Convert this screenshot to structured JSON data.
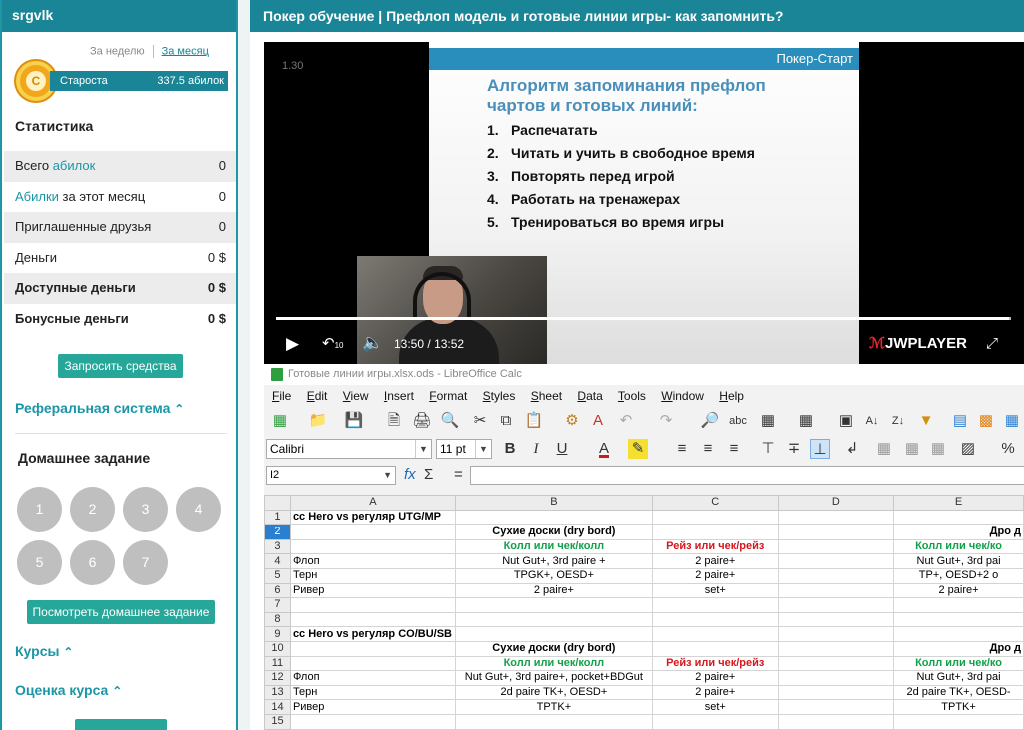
{
  "sidebar": {
    "username": "srgvlk",
    "period_week": "За неделю",
    "period_month": "За месяц",
    "coin_letter": "С",
    "rank": "Староста",
    "rank_points": "337.5 абилок",
    "stats_title": "Статистика",
    "stats": [
      {
        "pre": "Всего ",
        "link": "абилок",
        "post": "",
        "value": "0"
      },
      {
        "pre": "",
        "link": "Абилки",
        "post": " за этот месяц",
        "value": "0"
      },
      {
        "pre": "Приглашенные друзья",
        "link": "",
        "post": "",
        "value": "0"
      },
      {
        "pre": "Деньги",
        "link": "",
        "post": "",
        "value": "0 $"
      },
      {
        "pre": "Доступные деньги",
        "link": "",
        "post": "",
        "value": "0 $"
      },
      {
        "pre": "Бонусные деньги",
        "link": "",
        "post": "",
        "value": "0 $"
      }
    ],
    "request_funds": "Запросить средства",
    "referral": "Реферальная система",
    "homework_title": "Домашнее задание",
    "lessons": [
      "1",
      "2",
      "3",
      "4",
      "5",
      "6",
      "7"
    ],
    "view_homework": "Посмотреть домашнее задание",
    "courses": "Курсы",
    "course_rating": "Оценка курса",
    "chevron_up": "⌃"
  },
  "main": {
    "title": "Покер обучение | Префлоп модель и готовые линии игры- как запомнить?"
  },
  "video": {
    "timestamp_overlay": "1.30",
    "brand": "Покер-Старт",
    "slide_title_1": "Алгоритм запоминания префлоп",
    "slide_title_2": "чартов и готовых линий:",
    "slide_items": [
      {
        "n": "1.",
        "text": "Распечатать"
      },
      {
        "n": "2.",
        "text": "Читать и учить в свободное время"
      },
      {
        "n": "3.",
        "text": "Повторять перед игрой"
      },
      {
        "n": "4.",
        "text": "Работать на тренажерах"
      },
      {
        "n": "5.",
        "text": "Тренироваться во время игры"
      }
    ],
    "current_time": "13:50",
    "time_sep": "/",
    "duration": "13:52",
    "progress": 0.997,
    "player_logo_j": "ℳ",
    "player_logo": "JWPLAYER",
    "rewind_label": "10"
  },
  "calc": {
    "window_title": "Готовые линии игры.xlsx.ods - LibreOffice Calc",
    "menu": [
      {
        "u": "F",
        "rest": "ile"
      },
      {
        "u": "E",
        "rest": "dit"
      },
      {
        "u": "V",
        "rest": "iew"
      },
      {
        "u": "I",
        "rest": "nsert"
      },
      {
        "u": "F",
        "rest": "ormat"
      },
      {
        "u": "S",
        "rest": "tyles"
      },
      {
        "u": "S",
        "rest": "heet"
      },
      {
        "u": "D",
        "rest": "ata"
      },
      {
        "u": "T",
        "rest": "ools"
      },
      {
        "u": "W",
        "rest": "indow"
      },
      {
        "u": "H",
        "rest": "elp"
      }
    ],
    "font_name": "Calibri",
    "font_size": "11 pt",
    "cell_ref": "I2",
    "fx": "fx",
    "sigma": "Σ",
    "equals": "=",
    "columns": [
      "",
      "A",
      "B",
      "C",
      "D",
      "E"
    ],
    "rows": [
      {
        "n": "1",
        "cells": [
          {
            "t": "сс Hero vs регуляр UTG/MP",
            "cls": "b"
          },
          {
            "t": "",
            "cls": ""
          },
          {
            "t": "",
            "cls": ""
          },
          {
            "t": "",
            "cls": ""
          },
          {
            "t": "",
            "cls": ""
          }
        ]
      },
      {
        "n": "2",
        "sel": true,
        "cells": [
          {
            "t": "",
            "cls": ""
          },
          {
            "t": "Сухие доски (dry bord)",
            "cls": "c b"
          },
          {
            "t": "",
            "cls": ""
          },
          {
            "t": "",
            "cls": ""
          },
          {
            "t": "Дро д",
            "cls": "b rt"
          }
        ]
      },
      {
        "n": "3",
        "cells": [
          {
            "t": "",
            "cls": ""
          },
          {
            "t": "Колл или чек/колл",
            "cls": "g"
          },
          {
            "t": "Рейз или чек/рейз",
            "cls": "r"
          },
          {
            "t": "",
            "cls": ""
          },
          {
            "t": "Колл или чек/ко",
            "cls": "g"
          }
        ]
      },
      {
        "n": "4",
        "cells": [
          {
            "t": "Флоп",
            "cls": ""
          },
          {
            "t": "Nut Gut+, 3rd paire +",
            "cls": "c"
          },
          {
            "t": "2 paire+",
            "cls": "c"
          },
          {
            "t": "",
            "cls": ""
          },
          {
            "t": "Nut Gut+, 3rd pai",
            "cls": "c"
          }
        ]
      },
      {
        "n": "5",
        "cells": [
          {
            "t": "Терн",
            "cls": ""
          },
          {
            "t": "TPGK+, OESD+",
            "cls": "c"
          },
          {
            "t": "2 paire+",
            "cls": "c"
          },
          {
            "t": "",
            "cls": ""
          },
          {
            "t": "TP+, OESD+2 o",
            "cls": "c"
          }
        ]
      },
      {
        "n": "6",
        "cells": [
          {
            "t": "Ривер",
            "cls": ""
          },
          {
            "t": "2 paire+",
            "cls": "c"
          },
          {
            "t": "set+",
            "cls": "c"
          },
          {
            "t": "",
            "cls": ""
          },
          {
            "t": "2 paire+",
            "cls": "c"
          }
        ]
      },
      {
        "n": "7",
        "cells": [
          {
            "t": "",
            "cls": ""
          },
          {
            "t": "",
            "cls": ""
          },
          {
            "t": "",
            "cls": ""
          },
          {
            "t": "",
            "cls": ""
          },
          {
            "t": "",
            "cls": ""
          }
        ]
      },
      {
        "n": "8",
        "cells": [
          {
            "t": "",
            "cls": ""
          },
          {
            "t": "",
            "cls": ""
          },
          {
            "t": "",
            "cls": ""
          },
          {
            "t": "",
            "cls": ""
          },
          {
            "t": "",
            "cls": ""
          }
        ]
      },
      {
        "n": "9",
        "cells": [
          {
            "t": "сс Hero vs регуляр CO/BU/SB",
            "cls": "b"
          },
          {
            "t": "",
            "cls": ""
          },
          {
            "t": "",
            "cls": ""
          },
          {
            "t": "",
            "cls": ""
          },
          {
            "t": "",
            "cls": ""
          }
        ]
      },
      {
        "n": "10",
        "cells": [
          {
            "t": "",
            "cls": ""
          },
          {
            "t": "Сухие доски (dry bord)",
            "cls": "c b"
          },
          {
            "t": "",
            "cls": ""
          },
          {
            "t": "",
            "cls": ""
          },
          {
            "t": "Дро д",
            "cls": "b rt"
          }
        ]
      },
      {
        "n": "11",
        "cells": [
          {
            "t": "",
            "cls": ""
          },
          {
            "t": "Колл или чек/колл",
            "cls": "g"
          },
          {
            "t": "Рейз или чек/рейз",
            "cls": "r"
          },
          {
            "t": "",
            "cls": ""
          },
          {
            "t": "Колл или чек/ко",
            "cls": "g"
          }
        ]
      },
      {
        "n": "12",
        "cells": [
          {
            "t": "Флоп",
            "cls": ""
          },
          {
            "t": "Nut Gut+, 3rd paire+, pocket+BDGut",
            "cls": "c"
          },
          {
            "t": "2 paire+",
            "cls": "c"
          },
          {
            "t": "",
            "cls": ""
          },
          {
            "t": "Nut Gut+, 3rd pai",
            "cls": "c"
          }
        ]
      },
      {
        "n": "13",
        "cells": [
          {
            "t": "Терн",
            "cls": ""
          },
          {
            "t": "2d paire TK+, OESD+",
            "cls": "c"
          },
          {
            "t": "2 paire+",
            "cls": "c"
          },
          {
            "t": "",
            "cls": ""
          },
          {
            "t": "2d paire TK+, OESD-",
            "cls": "c"
          }
        ]
      },
      {
        "n": "14",
        "cells": [
          {
            "t": "Ривер",
            "cls": ""
          },
          {
            "t": "TPTK+",
            "cls": "c"
          },
          {
            "t": "set+",
            "cls": "c"
          },
          {
            "t": "",
            "cls": ""
          },
          {
            "t": "TPTK+",
            "cls": "c"
          }
        ]
      },
      {
        "n": "15",
        "cells": [
          {
            "t": "",
            "cls": ""
          },
          {
            "t": "",
            "cls": ""
          },
          {
            "t": "",
            "cls": ""
          },
          {
            "t": "",
            "cls": ""
          },
          {
            "t": "",
            "cls": ""
          }
        ]
      }
    ]
  }
}
